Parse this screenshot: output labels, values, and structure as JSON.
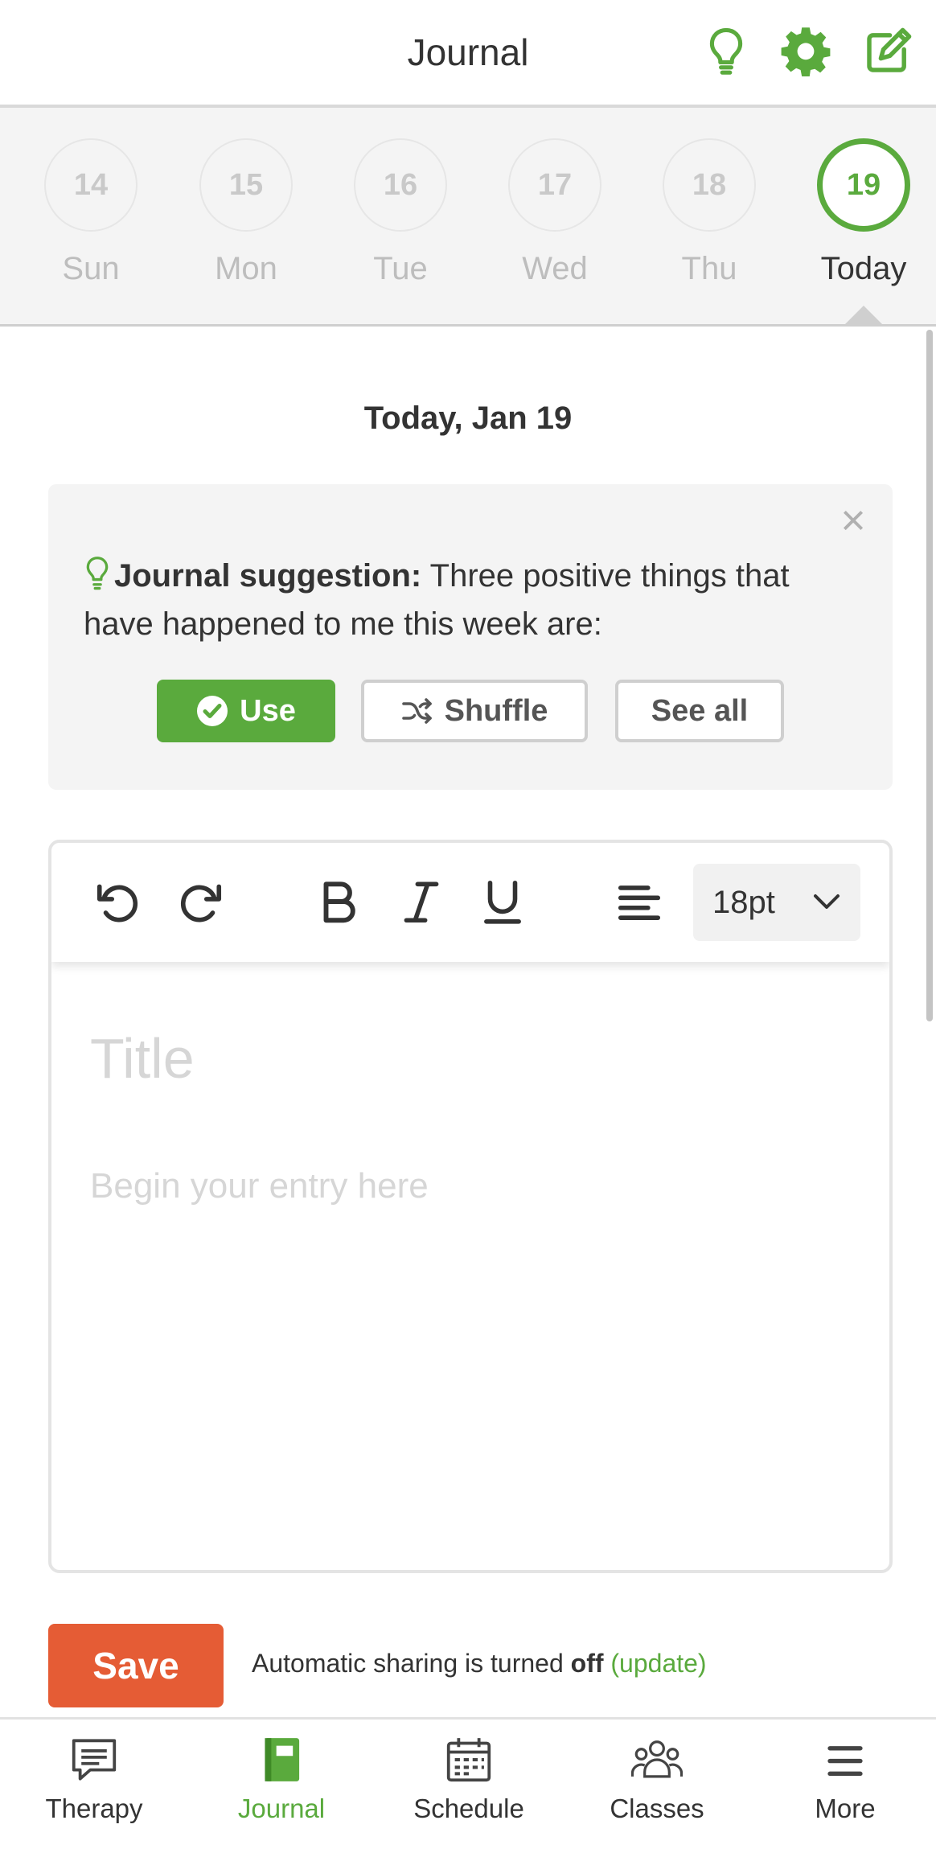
{
  "header": {
    "title": "Journal",
    "icons": [
      "lightbulb-icon",
      "gear-icon",
      "edit-icon"
    ],
    "accent": "#5aaa3d"
  },
  "days": [
    {
      "num": "14",
      "label": "Sun"
    },
    {
      "num": "15",
      "label": "Mon"
    },
    {
      "num": "16",
      "label": "Tue"
    },
    {
      "num": "17",
      "label": "Wed"
    },
    {
      "num": "18",
      "label": "Thu"
    },
    {
      "num": "19",
      "label": "Today"
    }
  ],
  "date_heading": "Today, Jan 19",
  "suggestion": {
    "prefix": "Journal suggestion:",
    "text": " Three positive things that have happened to me this week are:",
    "use_label": "Use",
    "shuffle_label": "Shuffle",
    "see_all_label": "See all",
    "close_glyph": "×"
  },
  "editor": {
    "font_size": "18pt",
    "title_placeholder": "Title",
    "body_placeholder": "Begin your entry here",
    "tools": [
      "undo-icon",
      "redo-icon",
      "bold-icon",
      "italic-icon",
      "underline-icon",
      "align-left-icon"
    ]
  },
  "save": {
    "label": "Save",
    "color": "#e55c35",
    "sharing_prefix": "Automatic sharing is turned ",
    "sharing_state": "off",
    "update_link": "(update)"
  },
  "nav": [
    {
      "label": "Therapy",
      "icon": "chat-icon",
      "active": false
    },
    {
      "label": "Journal",
      "icon": "journal-icon",
      "active": true
    },
    {
      "label": "Schedule",
      "icon": "calendar-icon",
      "active": false
    },
    {
      "label": "Classes",
      "icon": "group-icon",
      "active": false
    },
    {
      "label": "More",
      "icon": "menu-icon",
      "active": false
    }
  ]
}
